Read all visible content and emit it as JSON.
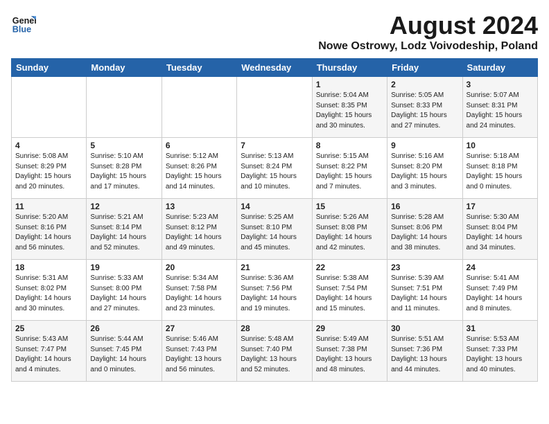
{
  "header": {
    "logo_line1": "General",
    "logo_line2": "Blue",
    "title": "August 2024",
    "subtitle": "Nowe Ostrowy, Lodz Voivodeship, Poland"
  },
  "days_of_week": [
    "Sunday",
    "Monday",
    "Tuesday",
    "Wednesday",
    "Thursday",
    "Friday",
    "Saturday"
  ],
  "weeks": [
    [
      {
        "day": "",
        "info": ""
      },
      {
        "day": "",
        "info": ""
      },
      {
        "day": "",
        "info": ""
      },
      {
        "day": "",
        "info": ""
      },
      {
        "day": "1",
        "info": "Sunrise: 5:04 AM\nSunset: 8:35 PM\nDaylight: 15 hours\nand 30 minutes."
      },
      {
        "day": "2",
        "info": "Sunrise: 5:05 AM\nSunset: 8:33 PM\nDaylight: 15 hours\nand 27 minutes."
      },
      {
        "day": "3",
        "info": "Sunrise: 5:07 AM\nSunset: 8:31 PM\nDaylight: 15 hours\nand 24 minutes."
      }
    ],
    [
      {
        "day": "4",
        "info": "Sunrise: 5:08 AM\nSunset: 8:29 PM\nDaylight: 15 hours\nand 20 minutes."
      },
      {
        "day": "5",
        "info": "Sunrise: 5:10 AM\nSunset: 8:28 PM\nDaylight: 15 hours\nand 17 minutes."
      },
      {
        "day": "6",
        "info": "Sunrise: 5:12 AM\nSunset: 8:26 PM\nDaylight: 15 hours\nand 14 minutes."
      },
      {
        "day": "7",
        "info": "Sunrise: 5:13 AM\nSunset: 8:24 PM\nDaylight: 15 hours\nand 10 minutes."
      },
      {
        "day": "8",
        "info": "Sunrise: 5:15 AM\nSunset: 8:22 PM\nDaylight: 15 hours\nand 7 minutes."
      },
      {
        "day": "9",
        "info": "Sunrise: 5:16 AM\nSunset: 8:20 PM\nDaylight: 15 hours\nand 3 minutes."
      },
      {
        "day": "10",
        "info": "Sunrise: 5:18 AM\nSunset: 8:18 PM\nDaylight: 15 hours\nand 0 minutes."
      }
    ],
    [
      {
        "day": "11",
        "info": "Sunrise: 5:20 AM\nSunset: 8:16 PM\nDaylight: 14 hours\nand 56 minutes."
      },
      {
        "day": "12",
        "info": "Sunrise: 5:21 AM\nSunset: 8:14 PM\nDaylight: 14 hours\nand 52 minutes."
      },
      {
        "day": "13",
        "info": "Sunrise: 5:23 AM\nSunset: 8:12 PM\nDaylight: 14 hours\nand 49 minutes."
      },
      {
        "day": "14",
        "info": "Sunrise: 5:25 AM\nSunset: 8:10 PM\nDaylight: 14 hours\nand 45 minutes."
      },
      {
        "day": "15",
        "info": "Sunrise: 5:26 AM\nSunset: 8:08 PM\nDaylight: 14 hours\nand 42 minutes."
      },
      {
        "day": "16",
        "info": "Sunrise: 5:28 AM\nSunset: 8:06 PM\nDaylight: 14 hours\nand 38 minutes."
      },
      {
        "day": "17",
        "info": "Sunrise: 5:30 AM\nSunset: 8:04 PM\nDaylight: 14 hours\nand 34 minutes."
      }
    ],
    [
      {
        "day": "18",
        "info": "Sunrise: 5:31 AM\nSunset: 8:02 PM\nDaylight: 14 hours\nand 30 minutes."
      },
      {
        "day": "19",
        "info": "Sunrise: 5:33 AM\nSunset: 8:00 PM\nDaylight: 14 hours\nand 27 minutes."
      },
      {
        "day": "20",
        "info": "Sunrise: 5:34 AM\nSunset: 7:58 PM\nDaylight: 14 hours\nand 23 minutes."
      },
      {
        "day": "21",
        "info": "Sunrise: 5:36 AM\nSunset: 7:56 PM\nDaylight: 14 hours\nand 19 minutes."
      },
      {
        "day": "22",
        "info": "Sunrise: 5:38 AM\nSunset: 7:54 PM\nDaylight: 14 hours\nand 15 minutes."
      },
      {
        "day": "23",
        "info": "Sunrise: 5:39 AM\nSunset: 7:51 PM\nDaylight: 14 hours\nand 11 minutes."
      },
      {
        "day": "24",
        "info": "Sunrise: 5:41 AM\nSunset: 7:49 PM\nDaylight: 14 hours\nand 8 minutes."
      }
    ],
    [
      {
        "day": "25",
        "info": "Sunrise: 5:43 AM\nSunset: 7:47 PM\nDaylight: 14 hours\nand 4 minutes."
      },
      {
        "day": "26",
        "info": "Sunrise: 5:44 AM\nSunset: 7:45 PM\nDaylight: 14 hours\nand 0 minutes."
      },
      {
        "day": "27",
        "info": "Sunrise: 5:46 AM\nSunset: 7:43 PM\nDaylight: 13 hours\nand 56 minutes."
      },
      {
        "day": "28",
        "info": "Sunrise: 5:48 AM\nSunset: 7:40 PM\nDaylight: 13 hours\nand 52 minutes."
      },
      {
        "day": "29",
        "info": "Sunrise: 5:49 AM\nSunset: 7:38 PM\nDaylight: 13 hours\nand 48 minutes."
      },
      {
        "day": "30",
        "info": "Sunrise: 5:51 AM\nSunset: 7:36 PM\nDaylight: 13 hours\nand 44 minutes."
      },
      {
        "day": "31",
        "info": "Sunrise: 5:53 AM\nSunset: 7:33 PM\nDaylight: 13 hours\nand 40 minutes."
      }
    ]
  ]
}
